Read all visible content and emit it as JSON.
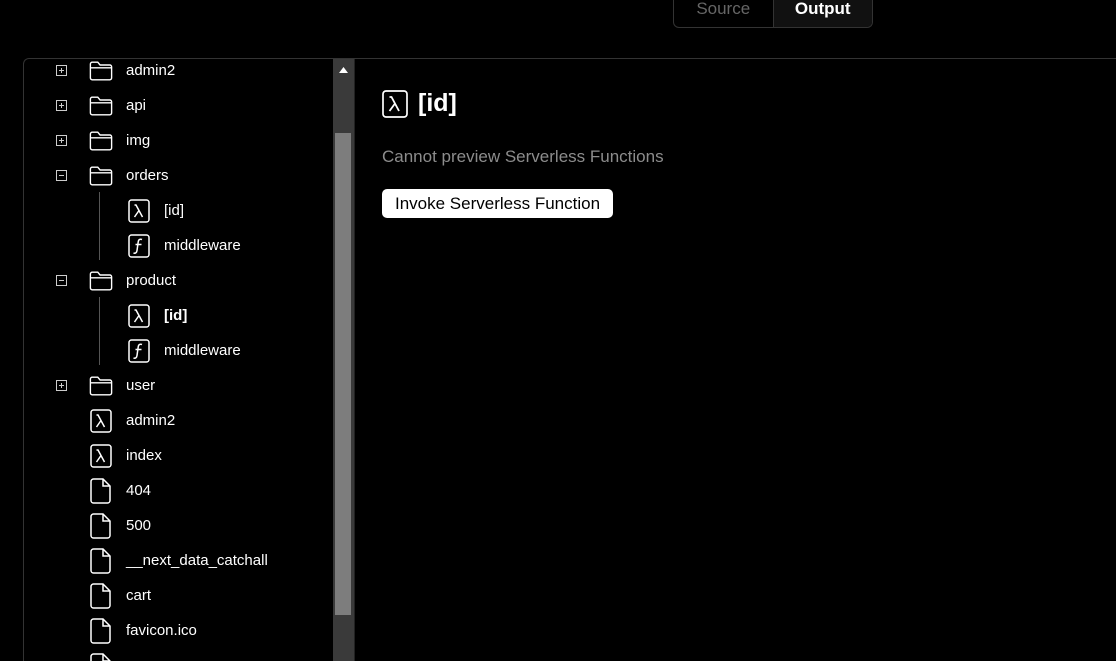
{
  "tabs": {
    "source_label": "Source",
    "output_label": "Output"
  },
  "tree": {
    "items": [
      {
        "label": "admin2",
        "icon": "folder-icon",
        "toggle": "plus"
      },
      {
        "label": "api",
        "icon": "folder-icon",
        "toggle": "plus"
      },
      {
        "label": "img",
        "icon": "folder-icon",
        "toggle": "plus"
      },
      {
        "label": "orders",
        "icon": "folder-icon",
        "toggle": "minus"
      },
      {
        "label": "[id]",
        "icon": "lambda-icon"
      },
      {
        "label": "middleware",
        "icon": "function-icon"
      },
      {
        "label": "product",
        "icon": "folder-icon",
        "toggle": "minus"
      },
      {
        "label": "[id]",
        "icon": "lambda-icon",
        "selected": true
      },
      {
        "label": "middleware",
        "icon": "function-icon"
      },
      {
        "label": "user",
        "icon": "folder-icon",
        "toggle": "plus"
      },
      {
        "label": "admin2",
        "icon": "lambda-icon"
      },
      {
        "label": "index",
        "icon": "lambda-icon"
      },
      {
        "label": "404",
        "icon": "file-icon"
      },
      {
        "label": "500",
        "icon": "file-icon"
      },
      {
        "label": "__next_data_catchall",
        "icon": "file-icon"
      },
      {
        "label": "cart",
        "icon": "file-icon"
      },
      {
        "label": "favicon.ico",
        "icon": "file-icon"
      }
    ]
  },
  "content": {
    "title": "[id]",
    "title_icon": "lambda-icon",
    "description": "Cannot preview Serverless Functions",
    "invoke_label": "Invoke Serverless Function"
  }
}
